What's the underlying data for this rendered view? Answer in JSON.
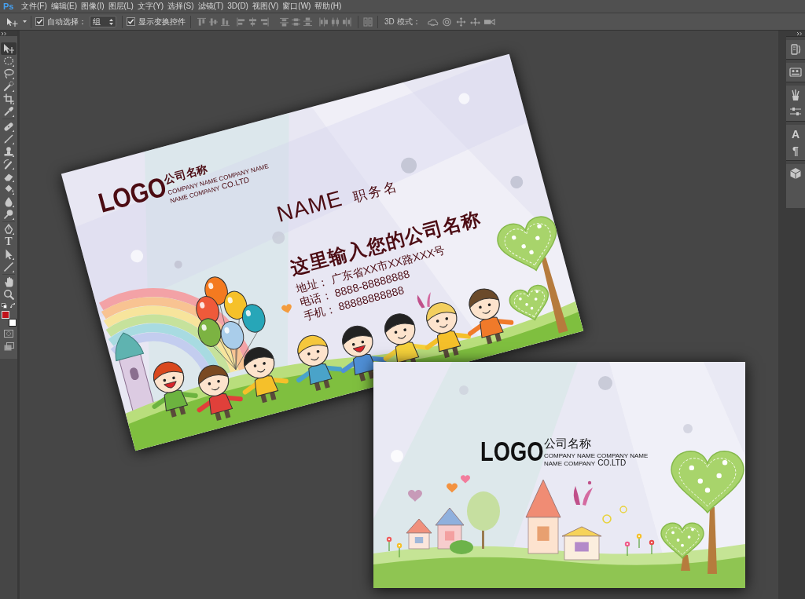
{
  "app": {
    "logo": "Ps"
  },
  "menu_bar": {
    "items": [
      "文件(F)",
      "编辑(E)",
      "图像(I)",
      "图层(L)",
      "文字(Y)",
      "选择(S)",
      "滤镜(T)",
      "3D(D)",
      "视图(V)",
      "窗口(W)",
      "帮助(H)"
    ]
  },
  "options_bar": {
    "auto_select": {
      "label": "自动选择：",
      "checked": true
    },
    "auto_select_target": {
      "value": "组"
    },
    "show_transform_controls": {
      "label": "显示变换控件",
      "checked": true
    },
    "mode_3d_label": "3D 模式："
  },
  "toolbar": {
    "tools": [
      {
        "kind": "icon",
        "selected": true
      },
      {
        "kind": "icon",
        "selected": false
      },
      {
        "kind": "icon",
        "selected": false
      },
      {
        "kind": "icon",
        "selected": false
      },
      {
        "kind": "icon",
        "selected": false
      },
      {
        "kind": "icon",
        "selected": false
      },
      {
        "kind": "icon",
        "selected": false
      },
      {
        "kind": "icon",
        "selected": false
      },
      {
        "kind": "icon",
        "selected": false
      },
      {
        "kind": "icon",
        "selected": false
      },
      {
        "kind": "icon",
        "selected": false
      },
      {
        "kind": "icon",
        "selected": false
      },
      {
        "kind": "icon",
        "selected": false
      },
      {
        "kind": "icon",
        "selected": false
      },
      {
        "kind": "icon",
        "selected": false
      },
      {
        "kind": "glyph",
        "label": "T",
        "selected": false
      },
      {
        "kind": "icon",
        "selected": false
      },
      {
        "kind": "icon",
        "selected": false
      },
      {
        "kind": "icon",
        "selected": false
      },
      {
        "kind": "icon",
        "selected": false
      }
    ],
    "swatches": [
      {
        "color": "#c0121a"
      },
      {
        "color": "#ffffff"
      }
    ]
  },
  "right_dock": {
    "groups": [
      {
        "buttons": [
          {
            "kind": "icon"
          }
        ]
      },
      {
        "buttons": [
          {
            "kind": "icon"
          }
        ]
      },
      {
        "buttons": [
          {
            "kind": "icon"
          },
          {
            "kind": "icon"
          }
        ]
      },
      {
        "buttons": [
          {
            "kind": "glyph",
            "label": "A"
          },
          {
            "kind": "glyph",
            "label": "¶"
          }
        ]
      },
      {
        "buttons": [
          {
            "kind": "icon"
          }
        ]
      }
    ]
  },
  "document": {
    "cards": [
      {
        "kind": "front",
        "logo": "LOGO",
        "company_name": "公司名称",
        "company_name_en": "COMPANY NAME COMPANY NAME",
        "company_name_en_2": "NAME COMPANY",
        "company_suffix": "CO.LTD",
        "person_name": "NAME",
        "job_title": "职务名",
        "company_full_name": "这里输入您的公司名称",
        "contacts": [
          {
            "label": "地址：",
            "value": "广东省XX市XX路XXX号"
          },
          {
            "label": "电话：",
            "value": "8888-88888888"
          },
          {
            "label": "手机：",
            "value": "88888888888"
          }
        ]
      },
      {
        "kind": "back",
        "logo": "LOGO",
        "company_name": "公司名称",
        "company_name_en": "COMPANY NAME COMPANY NAME",
        "company_name_en_2": "NAME COMPANY",
        "company_suffix": "CO.LTD"
      }
    ]
  }
}
